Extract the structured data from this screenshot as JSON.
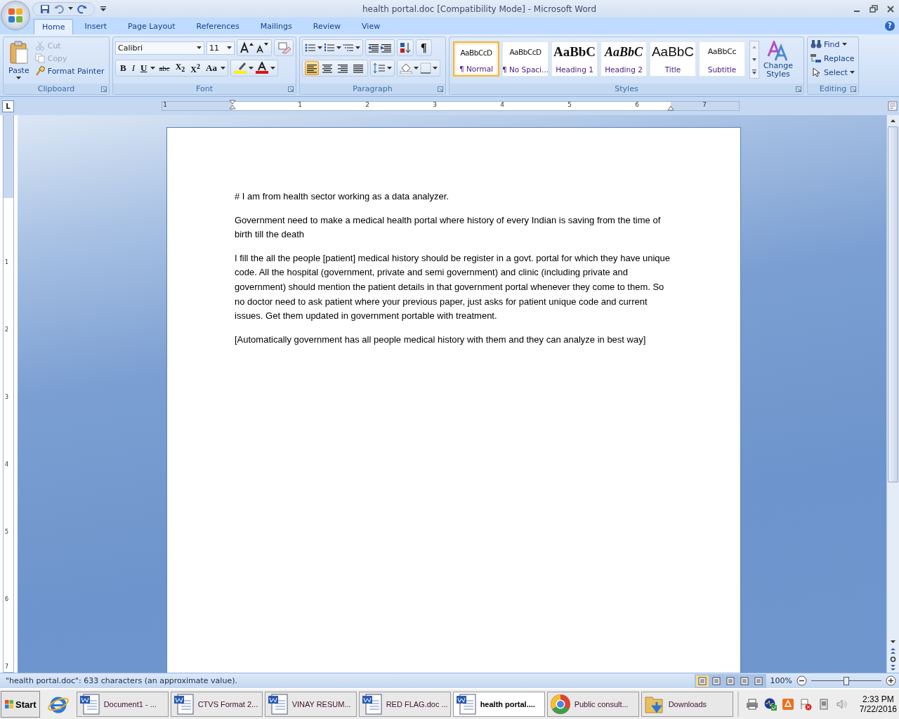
{
  "window": {
    "title": "health portal.doc [Compatibility Mode] - Microsoft Word"
  },
  "help": "?",
  "tabs": [
    {
      "label": "Home",
      "selected": true
    },
    {
      "label": "Insert",
      "selected": false
    },
    {
      "label": "Page Layout",
      "selected": false
    },
    {
      "label": "References",
      "selected": false
    },
    {
      "label": "Mailings",
      "selected": false
    },
    {
      "label": "Review",
      "selected": false
    },
    {
      "label": "View",
      "selected": false
    }
  ],
  "clipboard": {
    "label": "Clipboard",
    "paste": "Paste",
    "items": [
      {
        "label": "Cut",
        "kind": "cut",
        "disabled": true
      },
      {
        "label": "Copy",
        "kind": "copy",
        "disabled": true
      },
      {
        "label": "Format Painter",
        "kind": "painter",
        "disabled": false
      }
    ]
  },
  "font": {
    "label": "Font",
    "name": "Calibri",
    "size": "11",
    "format_buttons": [
      {
        "text": "B",
        "kind": "bold"
      },
      {
        "text": "I",
        "kind": "italic"
      },
      {
        "text": "U",
        "kind": "underline"
      },
      {
        "text": "abc",
        "kind": "strike"
      },
      {
        "text": "X$_{2}$",
        "kind": "sub"
      },
      {
        "text": "X$^{2}$",
        "kind": "sup"
      },
      {
        "text": "Aa",
        "kind": "case"
      }
    ]
  },
  "paragraph": {
    "label": "Paragraph",
    "pilcrow": "¶",
    "alignments": [
      {
        "kind": "left",
        "selected": true
      },
      {
        "kind": "center",
        "selected": false
      },
      {
        "kind": "right",
        "selected": false
      },
      {
        "kind": "justify",
        "selected": false
      }
    ]
  },
  "styles": {
    "label": "Styles",
    "items": [
      {
        "preview": "AaBbCcD",
        "name": "¶ Normal",
        "kind": "normal",
        "selected": true
      },
      {
        "preview": "AaBbCcD",
        "name": "¶ No Spaci...",
        "kind": "normal",
        "selected": false
      },
      {
        "preview": "AaBbC",
        "name": "Heading 1",
        "kind": "heading1",
        "selected": false
      },
      {
        "preview": "AaBbC",
        "name": "Heading 2",
        "kind": "heading2",
        "selected": false
      },
      {
        "preview": "AaBbC",
        "name": "Title",
        "kind": "title",
        "selected": false
      },
      {
        "preview": "AaBbCc",
        "name": "Subtitle",
        "kind": "subtitle",
        "selected": false
      }
    ],
    "change_styles": "Change Styles"
  },
  "editing": {
    "label": "Editing",
    "items": [
      {
        "label": "Find",
        "kind": "find"
      },
      {
        "label": "Replace",
        "kind": "replace"
      },
      {
        "label": "Select",
        "kind": "select"
      }
    ]
  },
  "ruler": {
    "tab_selector": "L",
    "horizontal": [
      "1",
      "1",
      "2",
      "3",
      "4",
      "5",
      "6",
      "7"
    ],
    "vertical": [
      "1",
      "2",
      "3",
      "4",
      "5",
      "6",
      "7"
    ]
  },
  "document": {
    "paragraphs": [
      "# I am from health sector working as a data analyzer.",
      "Government need to make a medical health portal where history of every Indian is saving from the time of birth till the death",
      "I fill the all the people [patient] medical history should be register in  a govt. portal for which they have unique code. All the hospital (government, private and semi government) and clinic (including private and government) should mention the patient details in that government portal whenever they come to them. So no doctor need to ask patient where your previous paper, just asks for patient unique code and current issues. Get them updated in government portable with treatment.",
      "[Automatically government has all people medical history with them and they can analyze in  best way]"
    ]
  },
  "status_bar": {
    "text": "\"health portal.doc\": 633 characters (an approximate value).",
    "views": [
      {
        "selected": true
      },
      {
        "selected": false
      },
      {
        "selected": false
      },
      {
        "selected": false
      },
      {
        "selected": false
      }
    ],
    "zoom": "100%",
    "level": 0.5
  },
  "taskbar": {
    "start": "Start",
    "items": [
      {
        "label": "Document1 - ...",
        "kind": "word",
        "selected": false
      },
      {
        "label": "CTVS Format 2...",
        "kind": "word",
        "selected": false
      },
      {
        "label": "VINAY RESUM...",
        "kind": "word",
        "selected": false
      },
      {
        "label": "RED FLAG.doc ...",
        "kind": "word",
        "selected": false
      },
      {
        "label": "health portal....",
        "kind": "word",
        "selected": true
      },
      {
        "label": "Public consult...",
        "kind": "browser",
        "selected": false
      },
      {
        "label": "Downloads",
        "kind": "folder",
        "selected": false
      }
    ],
    "time": "2:33 PM",
    "date": "7/22/2016"
  }
}
